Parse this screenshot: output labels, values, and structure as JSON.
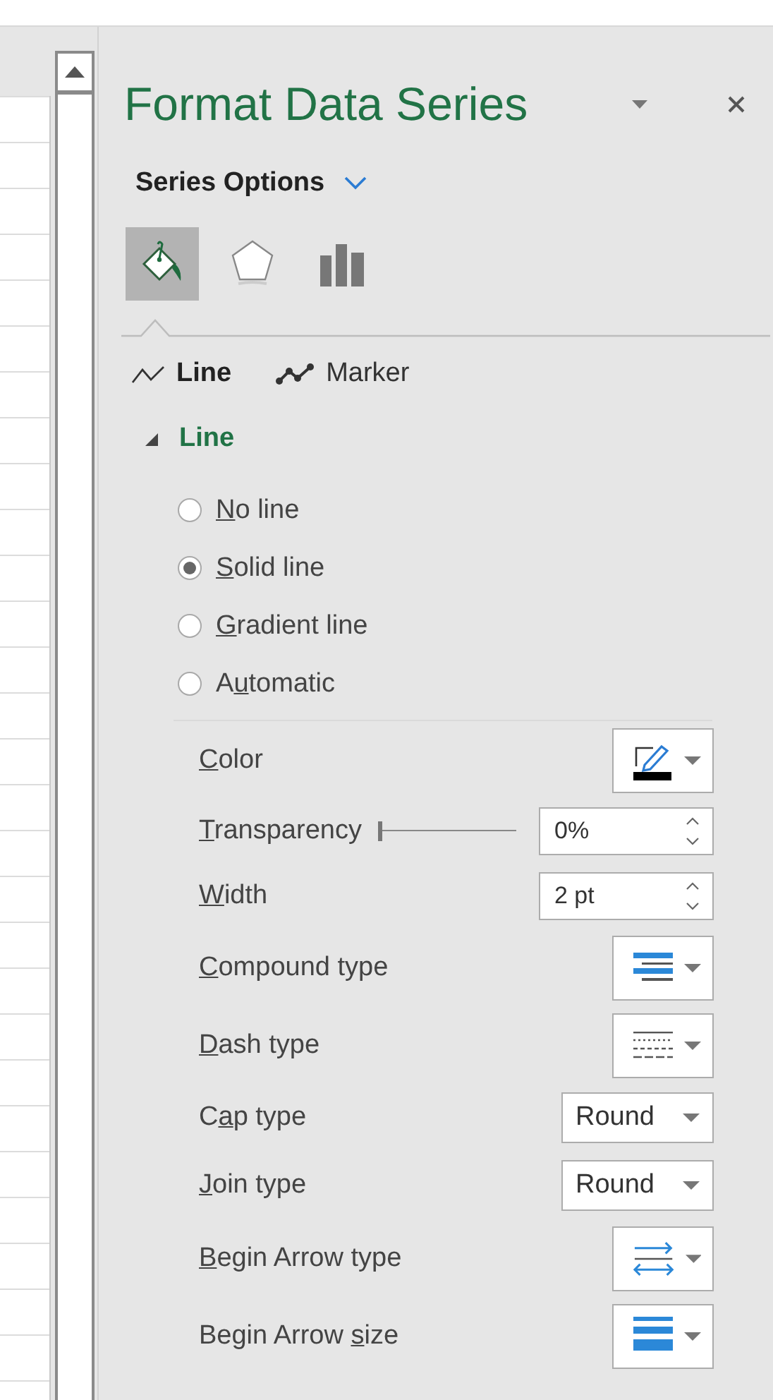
{
  "panel": {
    "title": "Format Data Series",
    "section_dropdown": "Series Options",
    "icon_tabs": [
      {
        "kind": "fill",
        "selected": true
      },
      {
        "kind": "effects",
        "selected": false
      },
      {
        "kind": "options",
        "selected": false
      }
    ],
    "subtabs": [
      {
        "label": "Line",
        "kind": "line",
        "selected": true
      },
      {
        "label": "Marker",
        "kind": "marker",
        "selected": false
      }
    ],
    "section": {
      "title": "Line",
      "expanded": true,
      "line_options": [
        {
          "label_parts": [
            {
              "text": "N",
              "underline": true
            },
            {
              "text": "o line",
              "underline": false
            }
          ],
          "selected": false
        },
        {
          "label_parts": [
            {
              "text": "S",
              "underline": true
            },
            {
              "text": "olid line",
              "underline": false
            }
          ],
          "selected": true
        },
        {
          "label_parts": [
            {
              "text": "G",
              "underline": true
            },
            {
              "text": "radient line",
              "underline": false
            }
          ],
          "selected": false
        },
        {
          "label_parts": [
            {
              "text": "A",
              "underline": false
            },
            {
              "text": "u",
              "underline": true
            },
            {
              "text": "tomatic",
              "underline": false
            }
          ],
          "selected": false
        }
      ],
      "properties": [
        {
          "label_parts": [
            {
              "text": "C",
              "underline": true
            },
            {
              "text": "olor",
              "underline": false
            }
          ],
          "kind": "color-picker"
        },
        {
          "label_parts": [
            {
              "text": "T",
              "underline": true
            },
            {
              "text": "ransparency",
              "underline": false
            }
          ],
          "kind": "spin",
          "value": "0%",
          "slider": {
            "level": 0
          }
        },
        {
          "label_parts": [
            {
              "text": "W",
              "underline": true
            },
            {
              "text": "idth",
              "underline": false
            }
          ],
          "kind": "spin",
          "value": "2 pt"
        },
        {
          "label_parts": [
            {
              "text": "C",
              "underline": true
            },
            {
              "text": "ompound type",
              "underline": false
            }
          ],
          "kind": "compound-picker"
        },
        {
          "label_parts": [
            {
              "text": "D",
              "underline": true
            },
            {
              "text": "ash type",
              "underline": false
            }
          ],
          "kind": "dash-picker"
        },
        {
          "label_parts": [
            {
              "text": "C",
              "underline": false
            },
            {
              "text": "a",
              "underline": true
            },
            {
              "text": "p type",
              "underline": false
            }
          ],
          "kind": "select",
          "value": "Round"
        },
        {
          "label_parts": [
            {
              "text": "J",
              "underline": true
            },
            {
              "text": "oin type",
              "underline": false
            }
          ],
          "kind": "select",
          "value": "Round"
        },
        {
          "label_parts": [
            {
              "text": "B",
              "underline": true
            },
            {
              "text": "egin Arrow type",
              "underline": false
            }
          ],
          "kind": "arrow-type-picker"
        },
        {
          "label_parts": [
            {
              "text": "Begin Arrow ",
              "underline": false
            },
            {
              "text": "s",
              "underline": true
            },
            {
              "text": "ize",
              "underline": false
            }
          ],
          "kind": "arrow-size-picker"
        }
      ]
    }
  }
}
